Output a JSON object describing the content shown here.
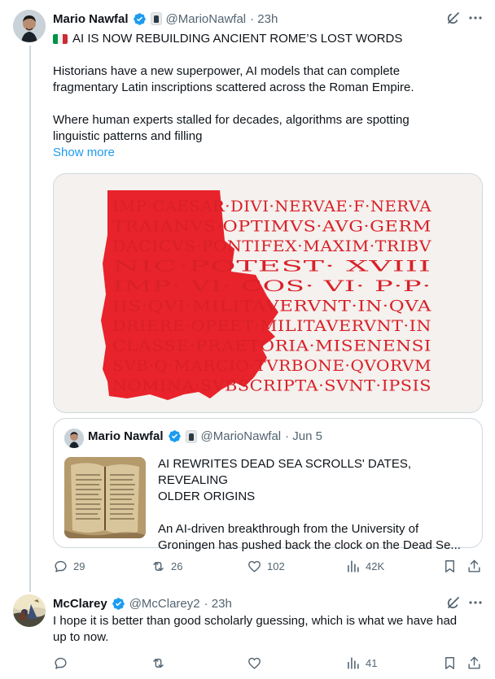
{
  "tweet": {
    "author_name": "Mario Nawfal",
    "handle": "@MarioNawfal",
    "time": "· 23h",
    "flag": "🇮🇹",
    "headline": "AI IS NOW REBUILDING ANCIENT ROME’S LOST WORDS",
    "para1_line1": "Historians have a new superpower,  AI models that can complete",
    "para1_line2": "fragmentary Latin inscriptions scattered across the Roman Empire.",
    "para2_line1": "Where human experts stalled for decades, algorithms are spotting",
    "para2_line2": "linguistic patterns and filling",
    "show_more": "Show more",
    "inscription_lines": [
      "IMP·CAESAR·DIVI·NERVAE·F·NERVA",
      "TRAIANVS·OPTIMVS·AVG·GERM",
      "DACICVS·PONTIFEX·MAXIM·TRIBV",
      "NIC·POTEST·    XVIII",
      "IMP·    VI·   COS·   VI·   P·P·",
      "IIS·QVI·MILITAVERVNT·IN·QVA",
      "DRIERE·OPEET·MILITAVERVNT·IN",
      "CLASSE·PRAETORIA·MISENENSI",
      "SVB·Q·MARCIO·TVRBONE·QVORVM",
      "NOMINA·SVBSCRIPTA·SVNT·IPSIS"
    ],
    "quote": {
      "author_name": "Mario Nawfal",
      "handle": "@MarioNawfal",
      "time": "· Jun 5",
      "title_line1": "AI REWRITES DEAD SEA SCROLLS' DATES, REVEALING",
      "title_line2": "OLDER ORIGINS",
      "body_line1": "An AI-driven breakthrough from the University of",
      "body_line2": "Groningen has pushed back the clock on the Dead Se..."
    },
    "actions": {
      "replies": "29",
      "reposts": "26",
      "likes": "102",
      "views": "42K"
    }
  },
  "reply": {
    "author_name": "McClarey",
    "handle": "@McClarey2",
    "time": "· 23h",
    "text_line1": "I hope it is better than good scholarly guessing, which is what we have had",
    "text_line2": "up to now.",
    "actions": {
      "views": "41"
    }
  },
  "colors": {
    "accent": "#1d9bf0",
    "muted": "#536471",
    "inscription_red": "#e8232b",
    "border": "#cfd9de"
  }
}
